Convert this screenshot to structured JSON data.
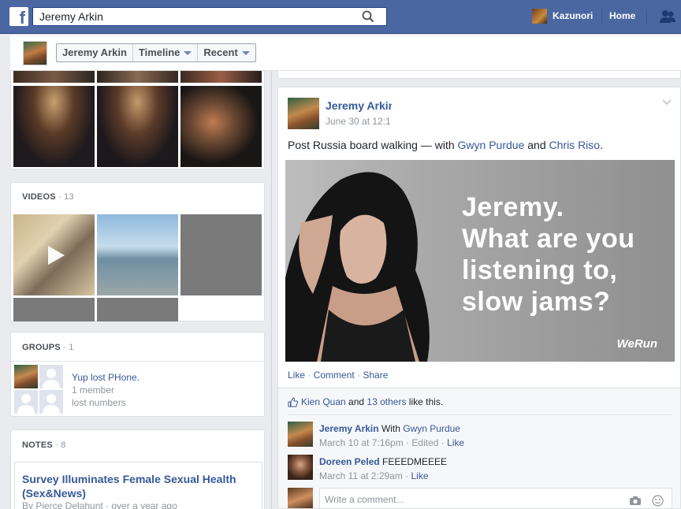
{
  "topbar": {
    "logo": "f",
    "search_value": "Jeremy Arkin",
    "user_name": "Kazunori",
    "home_label": "Home"
  },
  "subbar": {
    "name_button": "Jeremy Arkin",
    "timeline_button": "Timeline",
    "recent_button": "Recent"
  },
  "videos": {
    "title": "VIDEOS",
    "count": "· 13"
  },
  "groups": {
    "title": "GROUPS",
    "count": "· 1",
    "group_name": "Yup lost PHone.",
    "members": "1 member",
    "description": "lost numbers"
  },
  "notes": {
    "title": "NOTES",
    "count": "· 8",
    "note_title": "Survey Illuminates Female Sexual Health (Sex&News)",
    "note_meta": "By Pierce Delahunt · over a year ago"
  },
  "post": {
    "author": "Jeremy Arkin",
    "time": "June 30 at 12:1",
    "text_prefix": "Post Russia board walking — with ",
    "tag1": "Gwyn Purdue",
    "and": " and ",
    "tag2": "Chris Riso",
    "period": ".",
    "ad_line1": "Jeremy.",
    "ad_line2": "What are you",
    "ad_line3": "listening to,",
    "ad_line4": "slow jams?",
    "ad_brand": "WeRun",
    "like": "Like",
    "comment": "Comment",
    "share": "Share",
    "dot": " · ",
    "likes_name": "Kien Quan",
    "likes_and": " and ",
    "likes_others": "13 others",
    "likes_suffix": " like this."
  },
  "comments": [
    {
      "author": "Jeremy Arkin",
      "text_pre": " With ",
      "text_link": "Gwyn Purdue",
      "meta": "March 10 at 7:16pm · Edited · ",
      "action": "Like"
    },
    {
      "author": "Doreen Peled",
      "text_pre": " FEEEDMEEEE",
      "text_link": "",
      "meta": "March 11 at 2:29am · ",
      "action": "Like"
    }
  ],
  "write_comment_placeholder": "Write a comment...",
  "colors": {
    "brand": "#4b67a1",
    "link": "#365899",
    "muted": "#90949c"
  }
}
